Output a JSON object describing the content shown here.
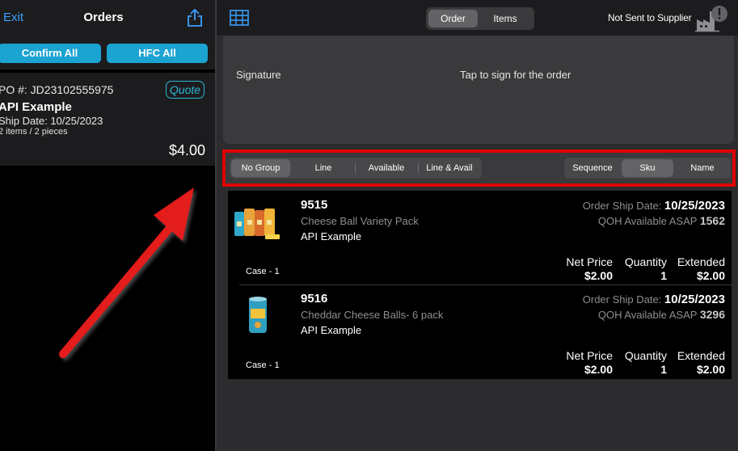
{
  "left": {
    "exit": "Exit",
    "title": "Orders",
    "confirm_all": "Confirm All",
    "hfc_all": "HFC All",
    "order": {
      "po": "PO #: JD23102555975",
      "badge": "Quote",
      "customer": "API Example",
      "ship_date": "Ship Date: 10/25/2023",
      "items": "2 items / 2 pieces",
      "total": "$4.00"
    }
  },
  "top": {
    "tabs": [
      "Order",
      "Items"
    ],
    "status": "Not Sent to Supplier"
  },
  "signature": {
    "label": "Signature",
    "hint": "Tap to sign for the order"
  },
  "group_by": [
    "No Group",
    "Line",
    "Available",
    "Line & Avail"
  ],
  "sort_by": [
    "Sequence",
    "Sku",
    "Name"
  ],
  "columns": {
    "net": "Net Price",
    "qty": "Quantity",
    "ext": "Extended",
    "ship_label": "Order Ship Date:",
    "qoh_label": "QOH Available ASAP"
  },
  "lines": [
    {
      "sku": "9515",
      "desc": "Cheese Ball Variety Pack",
      "customer": "API Example",
      "ship_date": "10/25/2023",
      "qoh": "1562",
      "unit": "Case - 1",
      "net": "$2.00",
      "qty": "1",
      "ext": "$2.00"
    },
    {
      "sku": "9516",
      "desc": "Cheddar Cheese Balls- 6 pack",
      "customer": "API Example",
      "ship_date": "10/25/2023",
      "qoh": "3296",
      "unit": "Case - 1",
      "net": "$2.00",
      "qty": "1",
      "ext": "$2.00"
    }
  ],
  "colors": {
    "accent": "#1ba3d1",
    "link": "#3aa0ff",
    "highlight": "#e00000"
  }
}
